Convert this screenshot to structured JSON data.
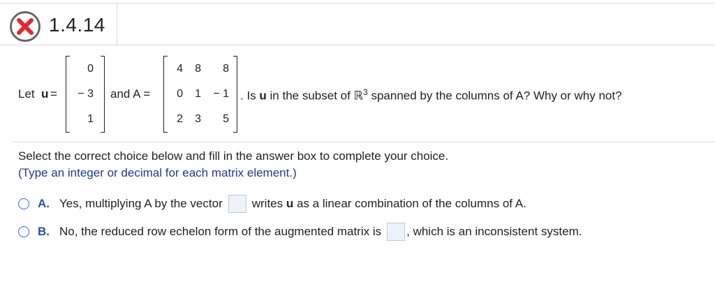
{
  "header": {
    "title": "1.4.14",
    "status": "incorrect"
  },
  "problem": {
    "let_u_label": "Let",
    "u_symbol": "u",
    "equals": "=",
    "u_vector": [
      "0",
      "− 3",
      "1"
    ],
    "and_label": "and A =",
    "matrix_A": [
      [
        "4",
        "8",
        "8"
      ],
      [
        "0",
        "1",
        "− 1"
      ],
      [
        "2",
        "3",
        "5"
      ]
    ],
    "question_prefix": ". Is",
    "question_u": "u",
    "question_mid": "in the subset of",
    "question_R": "ℝ",
    "question_exp": "3",
    "question_suffix": "spanned by the columns of A? Why or why not?"
  },
  "instructions": {
    "main": "Select the correct choice below and fill in the answer box to complete your choice.",
    "hint": "(Type an integer or decimal for each matrix element.)"
  },
  "choices": [
    {
      "letter": "A.",
      "before": "Yes, multiplying A by the vector",
      "after_pre": "writes",
      "after_bold": "u",
      "after_post": "as a linear combination of the columns of A."
    },
    {
      "letter": "B.",
      "before": "No, the reduced row echelon form of the augmented matrix is",
      "after_pre": ", which is an inconsistent system."
    }
  ],
  "colors": {
    "accent": "#2b6cd6",
    "hint": "#1f3a93",
    "error": "#e0292f"
  }
}
